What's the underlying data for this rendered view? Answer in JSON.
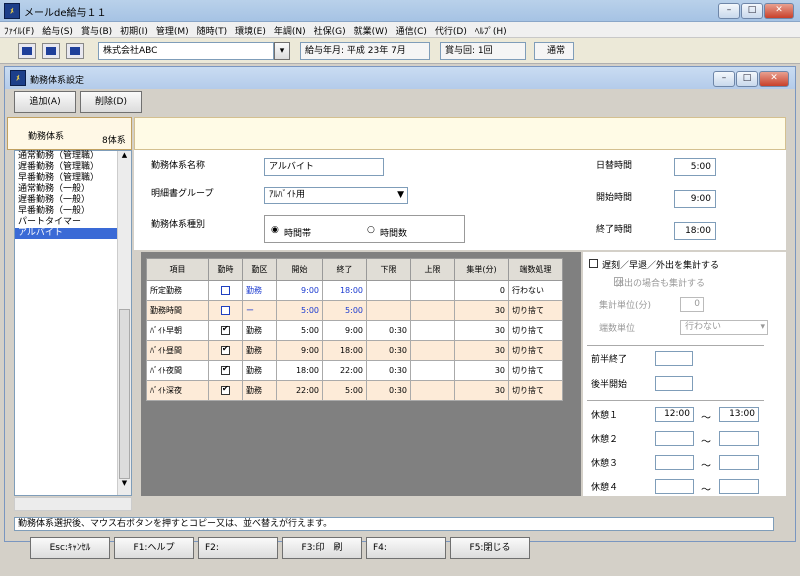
{
  "app": {
    "title": "メールde給与１１",
    "icon": "app-logo-icon"
  },
  "menu": [
    "ﾌｧｲﾙ(F)",
    "給与(S)",
    "賞与(B)",
    "初期(I)",
    "管理(M)",
    "随時(T)",
    "環境(E)",
    "年調(N)",
    "社保(G)",
    "就業(W)",
    "通信(C)",
    "代行(D)",
    "ﾍﾙﾌﾟ(H)"
  ],
  "toolbar": {
    "company": "株式会社ABC",
    "pay_month": "給与年月: 平成 23年  7月",
    "bonus": "賞与回: 1回",
    "mode": "通常"
  },
  "subwindow": {
    "title": "勤務体系設定",
    "add_label": "追加(A)",
    "delete_label": "削除(D)"
  },
  "list": {
    "header": "勤務体系",
    "count": "8体系",
    "items": [
      "通常勤務（管理職）",
      "遅番勤務（管理職）",
      "早番勤務（管理職）",
      "通常勤務（一般）",
      "遅番勤務（一般）",
      "早番勤務（一般）",
      "パートタイマー",
      "アルバイト"
    ],
    "selected_index": 7
  },
  "form": {
    "name_label": "勤務体系名称",
    "name_value": "アルバイト",
    "group_label": "明細書グループ",
    "group_value": "ｱﾙﾊﾞｲﾄ用",
    "type_label": "勤務体系種別",
    "radio1": "時間帯",
    "radio2": "時間数",
    "day_change_label": "日替時間",
    "day_change_value": "5:00",
    "start_label": "開始時間",
    "start_value": "9:00",
    "end_label": "終了時間",
    "end_value": "18:00"
  },
  "grid": {
    "headers": [
      "項目",
      "勤時",
      "勤区",
      "開始",
      "終了",
      "下限",
      "上限",
      "集単(分)",
      "端数処理"
    ],
    "rows": [
      {
        "item": "所定勤務",
        "checked": false,
        "kind": "勤務",
        "start": "9:00",
        "end": "18:00",
        "min": "",
        "max": "",
        "unit": "0",
        "round": "行わない",
        "blue": true
      },
      {
        "item": "勤務時間",
        "checked": false,
        "kind": "ー",
        "start": "5:00",
        "end": "5:00",
        "min": "",
        "max": "",
        "unit": "30",
        "round": "切り捨て",
        "blue": true
      },
      {
        "item": "ﾊﾞｲﾄ早朝",
        "checked": true,
        "kind": "勤務",
        "start": "5:00",
        "end": "9:00",
        "min": "0:30",
        "max": "",
        "unit": "30",
        "round": "切り捨て",
        "blue": false
      },
      {
        "item": "ﾊﾞｲﾄ昼間",
        "checked": true,
        "kind": "勤務",
        "start": "9:00",
        "end": "18:00",
        "min": "0:30",
        "max": "",
        "unit": "30",
        "round": "切り捨て",
        "blue": false
      },
      {
        "item": "ﾊﾞｲﾄ夜間",
        "checked": true,
        "kind": "勤務",
        "start": "18:00",
        "end": "22:00",
        "min": "0:30",
        "max": "",
        "unit": "30",
        "round": "切り捨て",
        "blue": false
      },
      {
        "item": "ﾊﾞｲﾄ深夜",
        "checked": true,
        "kind": "勤務",
        "start": "22:00",
        "end": "5:00",
        "min": "0:30",
        "max": "",
        "unit": "30",
        "round": "切り捨て",
        "blue": false
      }
    ]
  },
  "right": {
    "tally_label": "遅刻／早退／外出を集計する",
    "holiday_label": "休出の場合も集計する",
    "unit_label": "集計単位(分)",
    "unit_value": "0",
    "round_label": "端数単位",
    "round_value": "行わない",
    "early_end": "前半終了",
    "late_start": "後半開始",
    "breaks": [
      {
        "label": "休憩１",
        "from": "12:00",
        "to": "13:00"
      },
      {
        "label": "休憩２",
        "from": "",
        "to": ""
      },
      {
        "label": "休憩３",
        "from": "",
        "to": ""
      },
      {
        "label": "休憩４",
        "from": "",
        "to": ""
      }
    ],
    "tilde": "～"
  },
  "status": "勤務体系選択後、マウス右ボタンを押すとコピー又は、並べ替えが行えます。",
  "fkeys": [
    "Esc:ｷｬﾝｾﾙ",
    "F1:ヘルプ",
    "F2:",
    "F3:印　刷",
    "F4:",
    "F5:閉じる"
  ]
}
